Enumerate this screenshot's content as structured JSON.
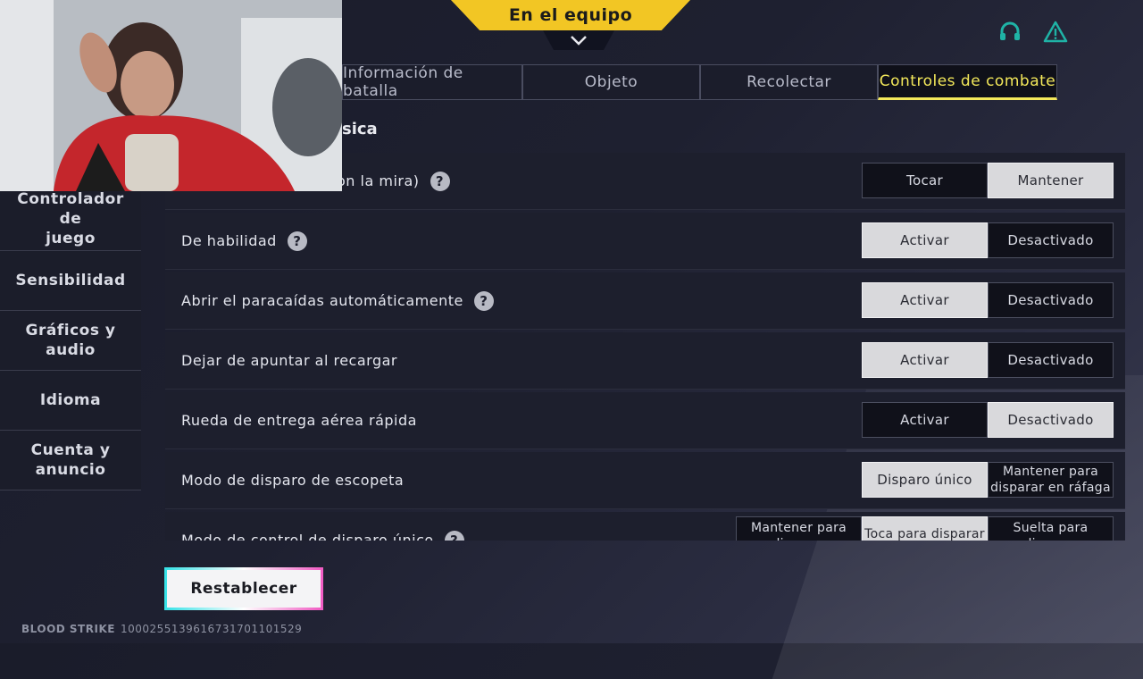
{
  "header": {
    "team_banner": "En el equipo",
    "icons": [
      "headset-icon",
      "warning-icon"
    ]
  },
  "tabs": [
    {
      "label": "Información de batalla",
      "active": false
    },
    {
      "label": "Objeto",
      "active": false
    },
    {
      "label": "Recolectar",
      "active": false
    },
    {
      "label": "Controles de combate",
      "active": true
    }
  ],
  "sidebar": {
    "items": [
      {
        "label": "Controlador de\njuego"
      },
      {
        "label": "Sensibilidad"
      },
      {
        "label": "Gráficos y\naudio"
      },
      {
        "label": "Idioma"
      },
      {
        "label": "Cuenta y\nanuncio"
      }
    ]
  },
  "section": {
    "title": "sica"
  },
  "settings": [
    {
      "label": "on la mira)",
      "help": true,
      "options": [
        "Tocar",
        "Mantener"
      ],
      "selected": 1
    },
    {
      "label": "De habilidad",
      "help": true,
      "options": [
        "Activar",
        "Desactivado"
      ],
      "selected": 0
    },
    {
      "label": "Abrir el paracaídas automáticamente",
      "help": true,
      "options": [
        "Activar",
        "Desactivado"
      ],
      "selected": 0
    },
    {
      "label": "Dejar de apuntar al recargar",
      "help": false,
      "options": [
        "Activar",
        "Desactivado"
      ],
      "selected": 0
    },
    {
      "label": "Rueda de entrega aérea rápida",
      "help": false,
      "options": [
        "Activar",
        "Desactivado"
      ],
      "selected": 1
    },
    {
      "label": "Modo de disparo de escopeta",
      "help": false,
      "options": [
        "Disparo único",
        "Mantener para disparar en ráfaga"
      ],
      "selected": 0
    },
    {
      "label": "Modo de control de disparo único",
      "help": true,
      "options": [
        "Mantener para disparar",
        "Toca para disparar",
        "Suelta para disparar"
      ],
      "selected": 1
    }
  ],
  "reset_button": {
    "label": "Restablecer"
  },
  "footer": {
    "brand": "BLOOD STRIKE",
    "id": "1000255139616731701101529"
  },
  "colors": {
    "accent_yellow": "#f2c624",
    "active_tab_text": "#f3e85a",
    "teal_icon": "#1fb3a6"
  }
}
